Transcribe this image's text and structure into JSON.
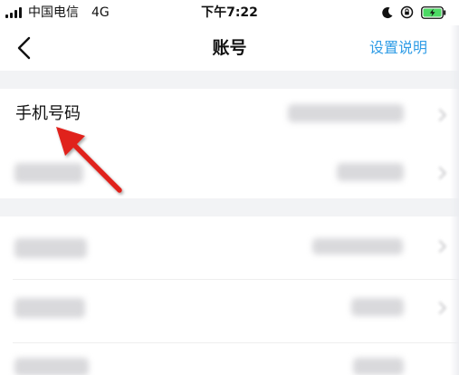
{
  "status_bar": {
    "carrier": "中国电信",
    "network": "4G",
    "time": "下午7:22"
  },
  "nav": {
    "title": "账号",
    "settings_link": "设置说明",
    "back_icon": "chevron-left-icon"
  },
  "rows": [
    {
      "label": "手机号码"
    }
  ],
  "colors": {
    "accent": "#2f9ce6",
    "separator": "#f2f3f5",
    "annotation_arrow": "#e0201c",
    "battery_fill": "#4cd964"
  }
}
